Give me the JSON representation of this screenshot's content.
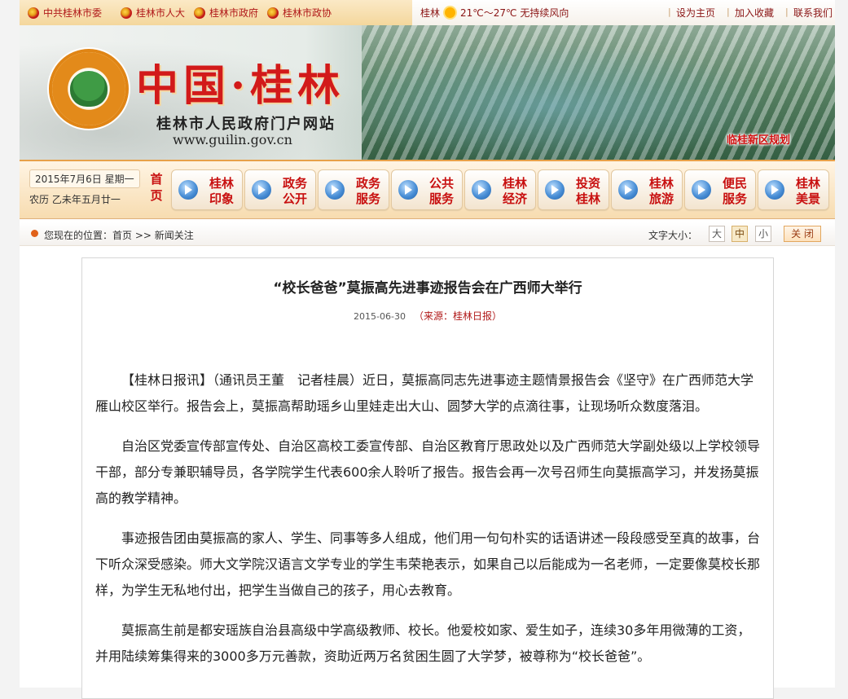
{
  "top_links": [
    {
      "label": "中共桂林市委"
    },
    {
      "label": "桂林市人大"
    },
    {
      "label": "桂林市政府"
    },
    {
      "label": "桂林市政协"
    }
  ],
  "weather": {
    "city": "桂林",
    "temp": "21℃～27℃",
    "desc": "无持续风向"
  },
  "utility_links": {
    "home": "设为主页",
    "favorite": "加入收藏",
    "contact": "联系我们"
  },
  "banner": {
    "title": "中国·桂林",
    "subtitle": "桂林市人民政府门户网站",
    "url": "www.guilin.gov.cn",
    "plan_label": "临桂新区规划"
  },
  "date": {
    "gregorian": "2015年7月6日 星期一",
    "lunar": "农历 乙未年五月廿一"
  },
  "nav": {
    "home": [
      "首",
      "页"
    ],
    "items": [
      {
        "l1": "桂林",
        "l2": "印象"
      },
      {
        "l1": "政务",
        "l2": "公开"
      },
      {
        "l1": "政务",
        "l2": "服务"
      },
      {
        "l1": "公共",
        "l2": "服务"
      },
      {
        "l1": "桂林",
        "l2": "经济"
      },
      {
        "l1": "投资",
        "l2": "桂林"
      },
      {
        "l1": "桂林",
        "l2": "旅游"
      },
      {
        "l1": "便民",
        "l2": "服务"
      },
      {
        "l1": "桂林",
        "l2": "美景"
      }
    ]
  },
  "breadcrumb": "您现在的位置：首页 >> 新闻关注",
  "font_size": {
    "label": "文字大小：",
    "large": "大",
    "medium": "中",
    "small": "小",
    "selected": "中"
  },
  "close_label": "关 闭",
  "article": {
    "title": "“校长爸爸”莫振高先进事迹报告会在广西师大举行",
    "date": "2015-06-30",
    "source": "（来源：桂林日报）",
    "paragraphs": [
      "【桂林日报讯】（通讯员王董　记者桂晨）近日，莫振高同志先进事迹主题情景报告会《坚守》在广西师范大学雁山校区举行。报告会上，莫振高帮助瑶乡山里娃走出大山、圆梦大学的点滴往事，让现场听众数度落泪。",
      "自治区党委宣传部宣传处、自治区高校工委宣传部、自治区教育厅思政处以及广西师范大学副处级以上学校领导干部，部分专兼职辅导员，各学院学生代表600余人聆听了报告。报告会再一次号召师生向莫振高学习，并发扬莫振高的教学精神。",
      "事迹报告团由莫振高的家人、学生、同事等多人组成，他们用一句句朴实的话语讲述一段段感受至真的故事，台下听众深受感染。师大文学院汉语言文学专业的学生韦荣艳表示，如果自己以后能成为一名老师，一定要像莫校长那样，为学生无私地付出，把学生当做自己的孩子，用心去教育。",
      "莫振高生前是都安瑶族自治县高级中学高级教师、校长。他爱校如家、爱生如子，连续30多年用微薄的工资，并用陆续筹集得来的3000多万元善款，资助近两万名贫困生圆了大学梦，被尊称为“校长爸爸”。"
    ]
  }
}
